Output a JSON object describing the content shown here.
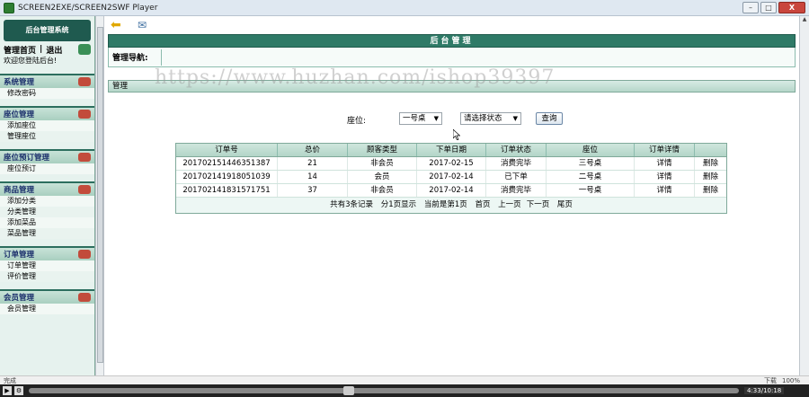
{
  "window": {
    "title": "SCREEN2EXE/SCREEN2SWF Player",
    "buttons": [
      "–",
      "□",
      "X"
    ]
  },
  "sidebar": {
    "header": "后台管理系统",
    "home_link": "管理首页",
    "separator": "|",
    "logout_link": "退出",
    "welcome": "欢迎您登陆后台!",
    "groups": [
      {
        "title": "系统管理",
        "items": [
          "修改密码"
        ]
      },
      {
        "title": "座位管理",
        "items": [
          "添加座位",
          "管理座位"
        ]
      },
      {
        "title": "座位预订管理",
        "items": [
          "座位预订"
        ]
      },
      {
        "title": "商品管理",
        "items": [
          "添加分类",
          "分类管理",
          "添加菜品",
          "菜品管理"
        ]
      },
      {
        "title": "订单管理",
        "items": [
          "订单管理",
          "评价管理"
        ]
      },
      {
        "title": "会员管理",
        "items": [
          "会员管理"
        ]
      }
    ]
  },
  "main": {
    "header_title": "后台管理",
    "nav_label": "管理导航:",
    "watermark": "https://www.huzhan.com/ishop39397",
    "section_label": "管理",
    "filter": {
      "seat_label": "座位:",
      "seat_selected": "一号桌",
      "status_selected": "请选择状态",
      "query_button": "查询"
    },
    "table": {
      "columns": [
        "订单号",
        "总价",
        "顾客类型",
        "下单日期",
        "订单状态",
        "座位",
        "订单详情",
        ""
      ],
      "rows": [
        [
          "201702151446351387",
          "21",
          "非会员",
          "2017-02-15",
          "消费完毕",
          "三号桌",
          "详情",
          "删除"
        ],
        [
          "201702141918051039",
          "14",
          "会员",
          "2017-02-14",
          "已下单",
          "二号桌",
          "详情",
          "删除"
        ],
        [
          "201702141831571751",
          "37",
          "非会员",
          "2017-02-14",
          "消费完毕",
          "一号桌",
          "详情",
          "删除"
        ]
      ]
    },
    "pager": {
      "total": "共有3条记录",
      "per_page": "分1页显示",
      "current": "当前是第1页",
      "first": "首页",
      "prev": "上一页",
      "next": "下一页",
      "last": "尾页"
    }
  },
  "statusbar": {
    "left": "完成",
    "download": "下载",
    "zoom": "100%"
  },
  "player": {
    "time": "4:33/10:18"
  }
}
